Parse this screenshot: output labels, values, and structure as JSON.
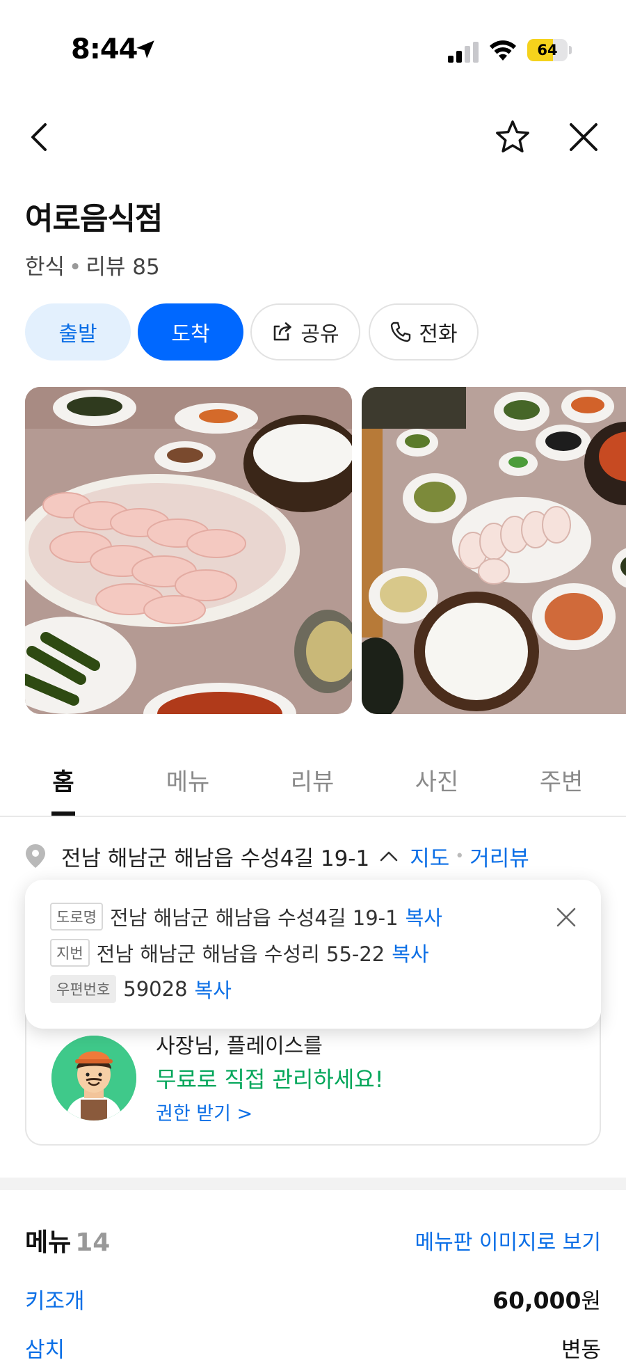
{
  "status_bar": {
    "time": "8:44",
    "battery": "64",
    "battery_level": 0.64
  },
  "place": {
    "name": "여로음식점",
    "category": "한식",
    "review_label": "리뷰 85"
  },
  "actions": {
    "depart": "출발",
    "arrive": "도착",
    "share": "공유",
    "call": "전화"
  },
  "tabs": [
    "홈",
    "메뉴",
    "리뷰",
    "사진",
    "주변"
  ],
  "active_tab": 0,
  "address": {
    "summary": "전남 해남군 해남읍 수성4길 19-1",
    "map_link": "지도",
    "roadview_link": "거리뷰",
    "road_tag": "도로명",
    "road": "전남 해남군 해남읍 수성4길 19-1",
    "lot_tag": "지번",
    "lot": "전남 해남군 해남읍 수성리 55-22",
    "zip_tag": "우편번호",
    "zip": "59028",
    "copy": "복사"
  },
  "owner_promo": {
    "line1": "사장님, 플레이스를",
    "line2": "무료로 직접 관리하세요!",
    "link": "권한 받기 >"
  },
  "menu": {
    "title": "메뉴",
    "count": "14",
    "image_link": "메뉴판 이미지로 보기",
    "items": [
      {
        "name": "키조개",
        "price": "60,000",
        "unit": "원"
      },
      {
        "name": "삼치",
        "price": "변동",
        "unit": ""
      }
    ]
  },
  "colors": {
    "accent": "#0068ff",
    "link": "#0a6ee6",
    "promo_green": "#03a65a",
    "battery": "#f5d21c"
  }
}
